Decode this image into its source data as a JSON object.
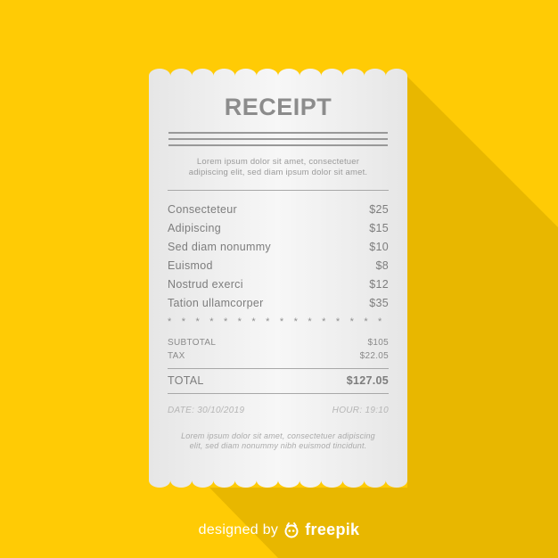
{
  "colors": {
    "background": "#FFCB05",
    "shadow": "#E8B700",
    "paper": "#F2F2F2",
    "text": "#7D7D7D"
  },
  "receipt": {
    "title": "RECEIPT",
    "intro_lines": [
      "Lorem ipsum dolor sit amet, consectetuer",
      "adipiscing elit, sed diam ipsum dolor sit amet."
    ],
    "items": [
      {
        "name": "Consecteteur",
        "price": "$25"
      },
      {
        "name": "Adipiscing",
        "price": "$15"
      },
      {
        "name": "Sed diam nonummy",
        "price": "$10"
      },
      {
        "name": "Euismod",
        "price": "$8"
      },
      {
        "name": "Nostrud exerci",
        "price": "$12"
      },
      {
        "name": "Tation ullamcorper",
        "price": "$35"
      }
    ],
    "stars": "* * * * * * * * * * * * * * * * *",
    "subtotal_label": "SUBTOTAL",
    "subtotal_value": "$105",
    "tax_label": "TAX",
    "tax_value": "$22.05",
    "total_label": "TOTAL",
    "total_value": "$127.05",
    "date": "DATE: 30/10/2019",
    "hour": "HOUR: 19:10",
    "footer_lines": [
      "Lorem ipsum dolor sit amet, consectetuer adipiscing",
      "elit, sed diam nonummy nibh euismod tincidunt."
    ]
  },
  "credit": {
    "prefix": "designed by",
    "icon": "freepik-logo-icon",
    "brand": "freepik"
  }
}
